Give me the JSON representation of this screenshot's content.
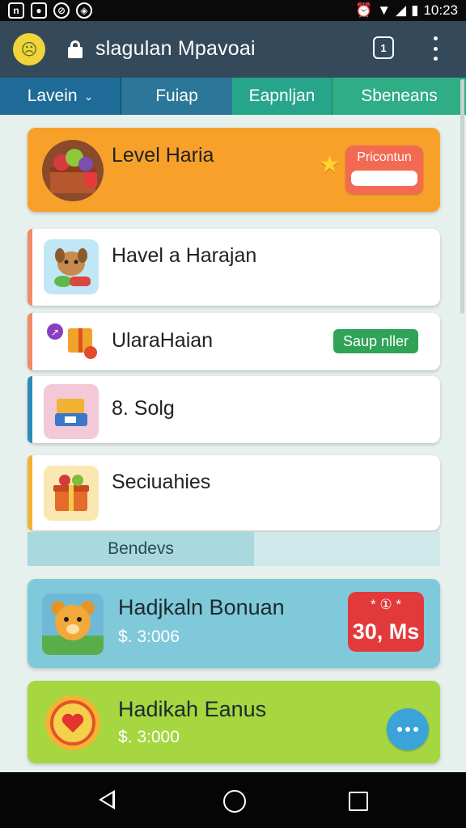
{
  "status_bar": {
    "time": "10:23",
    "icons": [
      "notification-n-icon",
      "image-icon",
      "link-icon",
      "location-icon",
      "alarm-icon",
      "wifi-icon",
      "signal-icon",
      "battery-icon"
    ]
  },
  "toolbar": {
    "title": "slagulan Mpavoai",
    "action_icon_text": "1",
    "icons": [
      "avatar-icon",
      "lock-icon",
      "tabs-icon",
      "more-vert-icon"
    ]
  },
  "tabs": [
    {
      "label": "Lavein"
    },
    {
      "label": "Fuiap"
    },
    {
      "label": "Eapnljan"
    },
    {
      "label": "Sbeneans"
    }
  ],
  "cards": {
    "level": {
      "title": "Level Haria",
      "badge": "Pricontun"
    },
    "item1": {
      "title": "Havel a Harajan"
    },
    "item2": {
      "title": "UlaraHaian",
      "badge": "Saup nller"
    },
    "item3": {
      "title": "8. Solg"
    },
    "item4": {
      "title": "Seciuahies"
    }
  },
  "section": {
    "title": "Bendevs"
  },
  "bonus": [
    {
      "title": "Hadjkaln Bonuan",
      "value": "$. 3:006",
      "badge_top": "* ① *",
      "badge_value": "30, Ms"
    },
    {
      "title": "Hadikah Eanus",
      "value": "$. 3:000"
    }
  ],
  "colors": {
    "toolbar": "#34495a",
    "orange_card": "#f7a12a",
    "blue_card": "#80c9da",
    "lime_card": "#a6d640",
    "sale_green": "#2fa356",
    "badge_red": "#e23a3a"
  }
}
